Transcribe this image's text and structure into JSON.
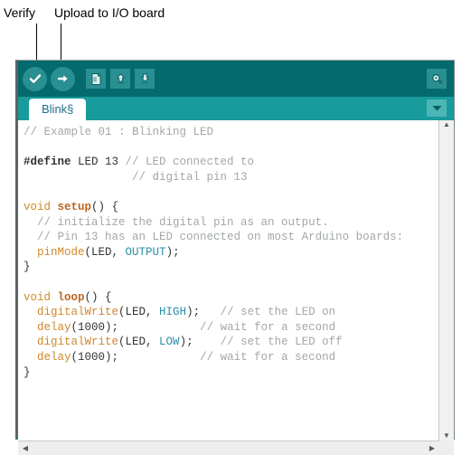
{
  "annotations": [
    {
      "id": "verify",
      "text": "Verify"
    },
    {
      "id": "upload",
      "text": "Upload to I/O board"
    }
  ],
  "toolbar": {
    "buttons": [
      {
        "name": "verify-button",
        "icon": "check-icon",
        "tooltip": "Verify"
      },
      {
        "name": "upload-button",
        "icon": "arrow-right-icon",
        "tooltip": "Upload to I/O board"
      },
      {
        "name": "new-button",
        "icon": "new-file-icon",
        "tooltip": "New"
      },
      {
        "name": "open-button",
        "icon": "open-folder-icon",
        "tooltip": "Open"
      },
      {
        "name": "save-button",
        "icon": "save-disk-icon",
        "tooltip": "Save"
      }
    ],
    "serial_monitor": {
      "name": "serial-monitor-button",
      "icon": "magnifier-icon",
      "tooltip": "Serial Monitor"
    }
  },
  "tabs": {
    "items": [
      {
        "label": "Blink§",
        "active": true
      }
    ],
    "dropdown": {
      "icon": "chevron-down-icon"
    }
  },
  "editor": {
    "code_lines": [
      {
        "tokens": [
          {
            "t": "// Example 01 : Blinking LED",
            "c": "tok-cmt"
          }
        ]
      },
      {
        "tokens": [
          {
            "t": "",
            "c": "tok-pln"
          }
        ]
      },
      {
        "tokens": [
          {
            "t": "#define",
            "c": "tok-pre"
          },
          {
            "t": " LED 13 ",
            "c": "tok-pln"
          },
          {
            "t": "// LED connected to",
            "c": "tok-cmt"
          }
        ]
      },
      {
        "tokens": [
          {
            "t": "                ",
            "c": "tok-pln"
          },
          {
            "t": "// digital pin 13",
            "c": "tok-cmt"
          }
        ]
      },
      {
        "tokens": [
          {
            "t": "",
            "c": "tok-pln"
          }
        ]
      },
      {
        "tokens": [
          {
            "t": "void",
            "c": "tok-kw"
          },
          {
            "t": " ",
            "c": "tok-pln"
          },
          {
            "t": "setup",
            "c": "tok-fnb"
          },
          {
            "t": "() {",
            "c": "tok-pln"
          }
        ]
      },
      {
        "tokens": [
          {
            "t": "  ",
            "c": "tok-pln"
          },
          {
            "t": "// initialize the digital pin as an output.",
            "c": "tok-cmt"
          }
        ]
      },
      {
        "tokens": [
          {
            "t": "  ",
            "c": "tok-pln"
          },
          {
            "t": "// Pin 13 has an LED connected on most Arduino boards:",
            "c": "tok-cmt"
          }
        ]
      },
      {
        "tokens": [
          {
            "t": "  ",
            "c": "tok-pln"
          },
          {
            "t": "pinMode",
            "c": "tok-fn"
          },
          {
            "t": "(LED, ",
            "c": "tok-pln"
          },
          {
            "t": "OUTPUT",
            "c": "tok-lit"
          },
          {
            "t": ");",
            "c": "tok-pln"
          }
        ]
      },
      {
        "tokens": [
          {
            "t": "}",
            "c": "tok-pln"
          }
        ]
      },
      {
        "tokens": [
          {
            "t": "",
            "c": "tok-pln"
          }
        ]
      },
      {
        "tokens": [
          {
            "t": "void",
            "c": "tok-kw"
          },
          {
            "t": " ",
            "c": "tok-pln"
          },
          {
            "t": "loop",
            "c": "tok-fnb"
          },
          {
            "t": "() {",
            "c": "tok-pln"
          }
        ]
      },
      {
        "tokens": [
          {
            "t": "  ",
            "c": "tok-pln"
          },
          {
            "t": "digitalWrite",
            "c": "tok-fn"
          },
          {
            "t": "(LED, ",
            "c": "tok-pln"
          },
          {
            "t": "HIGH",
            "c": "tok-lit"
          },
          {
            "t": ");",
            "c": "tok-pln"
          },
          {
            "t": "   ",
            "c": "tok-pln"
          },
          {
            "t": "// set the LED on",
            "c": "tok-cmt"
          }
        ]
      },
      {
        "tokens": [
          {
            "t": "  ",
            "c": "tok-pln"
          },
          {
            "t": "delay",
            "c": "tok-fn"
          },
          {
            "t": "(1000);",
            "c": "tok-pln"
          },
          {
            "t": "            ",
            "c": "tok-pln"
          },
          {
            "t": "// wait for a second",
            "c": "tok-cmt"
          }
        ]
      },
      {
        "tokens": [
          {
            "t": "  ",
            "c": "tok-pln"
          },
          {
            "t": "digitalWrite",
            "c": "tok-fn"
          },
          {
            "t": "(LED, ",
            "c": "tok-pln"
          },
          {
            "t": "LOW",
            "c": "tok-lit"
          },
          {
            "t": ");",
            "c": "tok-pln"
          },
          {
            "t": "    ",
            "c": "tok-pln"
          },
          {
            "t": "// set the LED off",
            "c": "tok-cmt"
          }
        ]
      },
      {
        "tokens": [
          {
            "t": "  ",
            "c": "tok-pln"
          },
          {
            "t": "delay",
            "c": "tok-fn"
          },
          {
            "t": "(1000);",
            "c": "tok-pln"
          },
          {
            "t": "            ",
            "c": "tok-pln"
          },
          {
            "t": "// wait for a second",
            "c": "tok-cmt"
          }
        ]
      },
      {
        "tokens": [
          {
            "t": "}",
            "c": "tok-pln"
          }
        ]
      }
    ]
  },
  "scrollbars": {
    "vertical": {
      "up": "▲",
      "down": "▼"
    },
    "horizontal": {
      "left": "◀",
      "right": "▶"
    }
  },
  "colors": {
    "toolbar_bg": "#046a6d",
    "tabstrip_bg": "#199a9b",
    "button_bg": "#2a8f90",
    "tab_active_bg": "#ffffff",
    "tab_active_text": "#1d6e86",
    "comment": "#a2a8a6",
    "keyword": "#cc8c22",
    "function": "#d0872a",
    "literal": "#2a8fa8"
  }
}
